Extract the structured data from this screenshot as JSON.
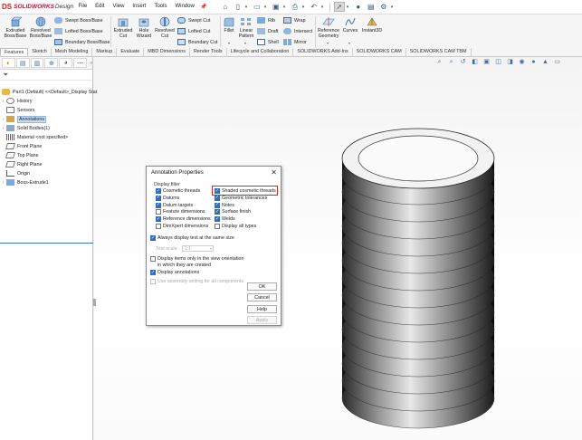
{
  "app": {
    "brand_prefix": "DS",
    "brand_name": "SOLIDWORKS",
    "brand_suffix": "Design"
  },
  "menu": [
    "File",
    "Edit",
    "View",
    "Insert",
    "Tools",
    "Window"
  ],
  "ribbon": {
    "extruded_boss": "Extruded Boss/Base",
    "revolved_boss": "Revolved Boss/Base",
    "swept_boss": "Swept Boss/Base",
    "lofted_boss": "Lofted Boss/Base",
    "boundary_boss": "Boundary Boss/Base",
    "extruded_cut": "Extruded Cut",
    "hole_wizard": "Hole Wizard",
    "revolved_cut": "Revolved Cut",
    "swept_cut": "Swept Cut",
    "lofted_cut": "Lofted Cut",
    "boundary_cut": "Boundary Cut",
    "fillet": "Fillet",
    "linear_pattern": "Linear Pattern",
    "rib": "Rib",
    "draft": "Draft",
    "shell": "Shell",
    "wrap": "Wrap",
    "intersect": "Intersect",
    "mirror": "Mirror",
    "reference_geometry": "Reference Geometry",
    "curves": "Curves",
    "instant3d": "Instant3D"
  },
  "tabs": [
    "Features",
    "Sketch",
    "Mesh Modeling",
    "Markup",
    "Evaluate",
    "MBD Dimensions",
    "Render Tools",
    "Lifecycle and Collaboration",
    "SOLIDWORKS Add-Ins",
    "SOLIDWORKS CAM",
    "SOLIDWORKS CAM TBM"
  ],
  "tree": {
    "root": "Part1 (Default) <<Default>_Display Stat",
    "items": [
      "History",
      "Sensors",
      "Annotations",
      "Solid Bodies(1)",
      "Material <not specified>",
      "Front Plane",
      "Top Plane",
      "Right Plane",
      "Origin",
      "Boss-Extrude1"
    ]
  },
  "dialog": {
    "title": "Annotation Properties",
    "close": "✕",
    "display_filter_label": "Display filter",
    "filters": [
      {
        "label": "Cosmetic threads",
        "checked": true
      },
      {
        "label": "Datums",
        "checked": true
      },
      {
        "label": "Datum targets",
        "checked": true
      },
      {
        "label": "Feature dimensions",
        "checked": false
      },
      {
        "label": "Reference dimensions",
        "checked": true
      },
      {
        "label": "DimXpert dimensions",
        "checked": false
      },
      {
        "label": "Shaded cosmetic threads",
        "checked": true
      },
      {
        "label": "Geometric tolerances",
        "checked": true
      },
      {
        "label": "Notes",
        "checked": true
      },
      {
        "label": "Surface finish",
        "checked": true
      },
      {
        "label": "Welds",
        "checked": true
      },
      {
        "label": "Display all types",
        "checked": false
      }
    ],
    "same_size": {
      "label": "Always display text at the same size",
      "checked": true
    },
    "text_scale_label": "Text scale:",
    "text_scale_value": "1:1",
    "view_orientation": {
      "label_line1": "Display items only in the view orientation",
      "label_line2": "in which they are created",
      "checked": false
    },
    "display_annotations": {
      "label": "Display annotations",
      "checked": true
    },
    "assembly_setting": {
      "label": "Use assembly setting for all components",
      "checked": false
    },
    "ok": "OK",
    "cancel": "Cancel",
    "help": "Help",
    "apply": "Apply"
  }
}
